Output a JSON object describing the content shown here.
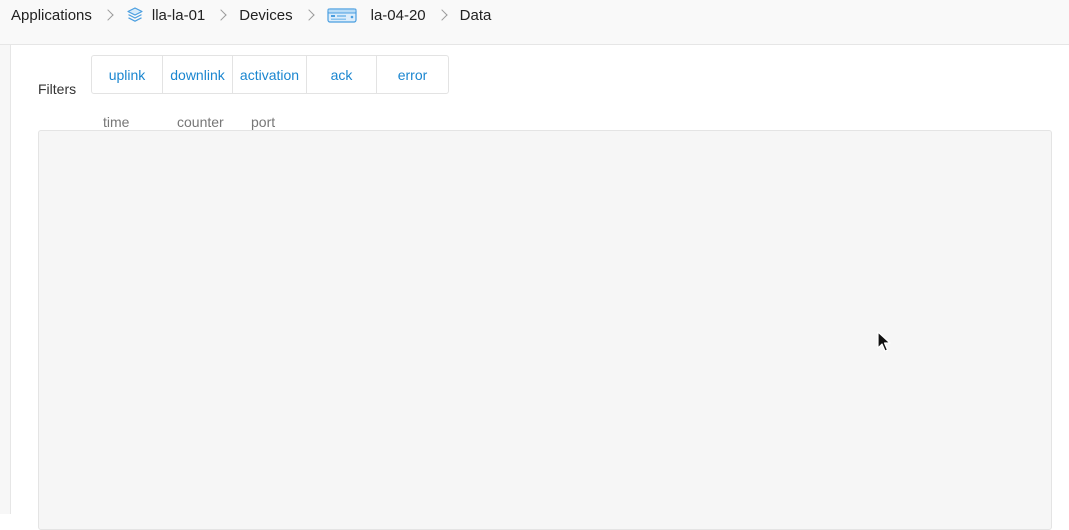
{
  "breadcrumb": {
    "applications": "Applications",
    "application": "lla-la-01",
    "devices": "Devices",
    "device": "la-04-20",
    "current": "Data"
  },
  "filters": {
    "label": "Filters",
    "buttons": [
      "uplink",
      "downlink",
      "activation",
      "ack",
      "error"
    ]
  },
  "table": {
    "columns": [
      "time",
      "counter",
      "port"
    ]
  },
  "colors": {
    "accent": "#1a86d0",
    "icon_blue": "#4a9ee0",
    "panel_bg": "#f6f6f6"
  },
  "icons": {
    "application": "layers-icon",
    "device": "device-icon",
    "separator": "chevron-right-icon"
  }
}
